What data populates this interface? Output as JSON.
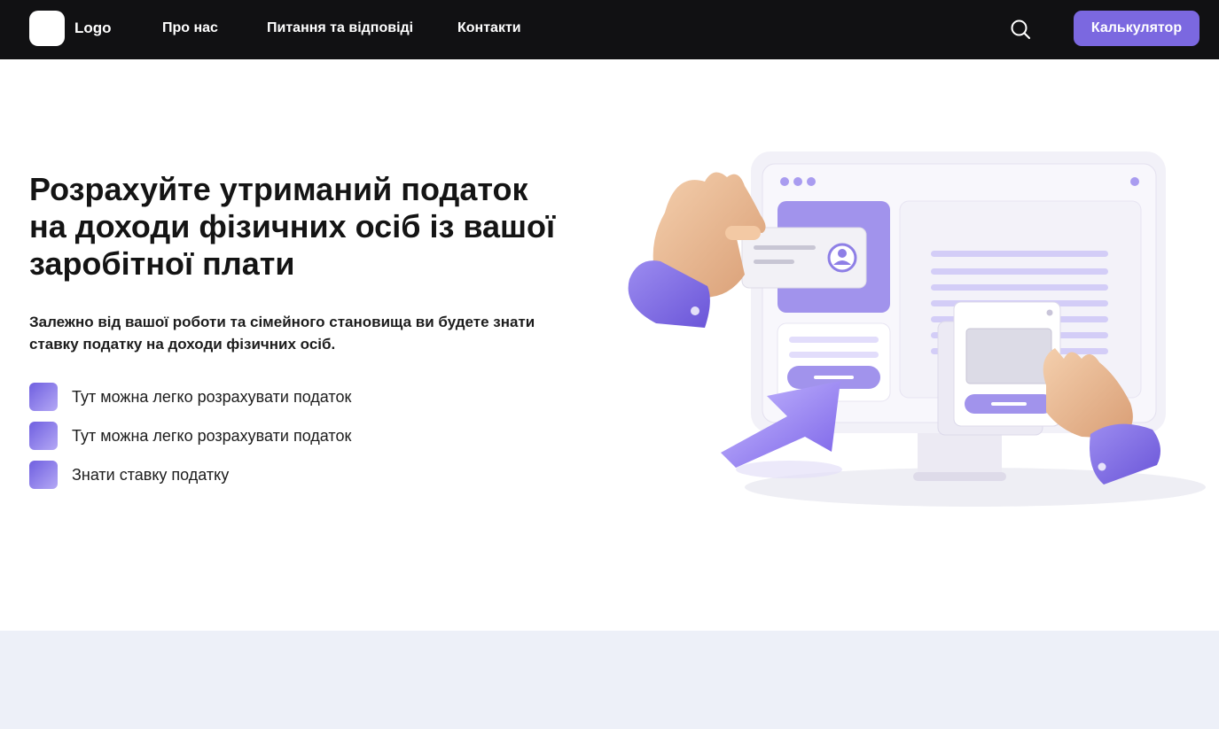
{
  "header": {
    "logo_label": "Logo",
    "nav": [
      {
        "label": "Про нас"
      },
      {
        "label": "Питання та відповіді"
      },
      {
        "label": "Контакти"
      }
    ],
    "search_icon": "search-icon",
    "cta_label": "Калькулятор"
  },
  "hero": {
    "title": "Розрахуйте утриманий податок на доходи фізичних осіб із вашої заробітної плати",
    "subtitle": "Залежно від вашої роботи та сімейного становища ви будете знати ставку податку на доходи фізичних осіб.",
    "features": [
      {
        "label": "Тут можна легко розрахувати податок"
      },
      {
        "label": "Тут можна легко розрахувати податок"
      },
      {
        "label": "Знати ставку податку"
      }
    ]
  },
  "colors": {
    "accent": "#7b68e0",
    "header_bg": "#111113",
    "footer_bg": "#edf0f8"
  }
}
